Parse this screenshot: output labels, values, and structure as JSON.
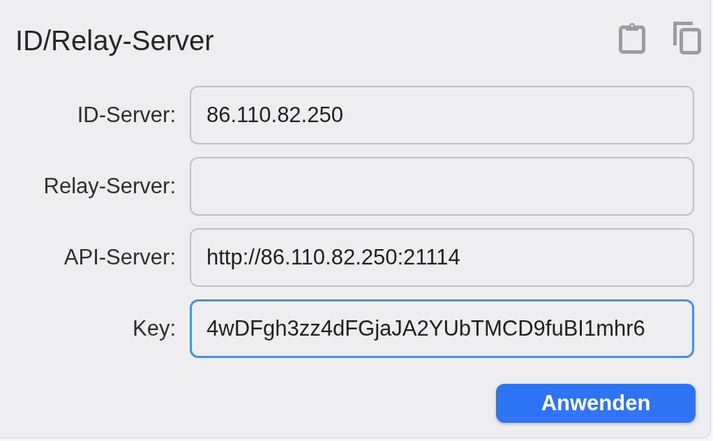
{
  "section": {
    "title": "ID/Relay-Server"
  },
  "fields": [
    {
      "label": "ID-Server:",
      "value": "86.110.82.250",
      "focused": false
    },
    {
      "label": "Relay-Server:",
      "focused": false
    },
    {
      "label": "API-Server:",
      "value": "http://86.110.82.250:21114",
      "focused": false
    },
    {
      "label": "Key:",
      "value": "4wDFgh3zz4dFGjaJA2YUbTMCD9fuBI1mhr6",
      "focused": true
    }
  ],
  "apply_button": {
    "label": "Anwenden"
  }
}
